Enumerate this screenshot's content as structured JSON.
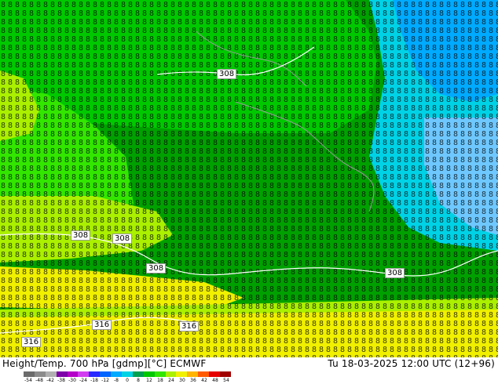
{
  "title_left": "Height/Temp. 700 hPa [gdmp][°C] ECMWF",
  "title_right": "Tu 18-03-2025 12:00 UTC (12+96)",
  "height_labels": [
    "308",
    "308",
    "308",
    "308",
    "308",
    "316",
    "316",
    "316"
  ],
  "colorbar": {
    "ticks": [
      "-54",
      "-48",
      "-42",
      "-38",
      "-30",
      "-24",
      "-18",
      "-12",
      "-8",
      "0",
      "8",
      "12",
      "18",
      "24",
      "30",
      "36",
      "42",
      "48",
      "54"
    ],
    "colors": [
      "#6b6b6b",
      "#8c8c8c",
      "#b0b0b0",
      "#7d00a8",
      "#b400c8",
      "#d23cf0",
      "#2828ff",
      "#0064ff",
      "#00aaff",
      "#00d2e6",
      "#00a050",
      "#00c800",
      "#32e600",
      "#aaf000",
      "#f0f000",
      "#ffb400",
      "#ff5a00",
      "#e60000",
      "#a00000"
    ]
  },
  "palette": {
    "dark_green": "#00a000",
    "green": "#00c800",
    "bright_green": "#32e600",
    "yellow_green": "#aaf000",
    "yellow": "#f0f000",
    "cyan": "#00d2e6",
    "blue": "#00aaff",
    "light_blue": "#6ec8ff"
  }
}
